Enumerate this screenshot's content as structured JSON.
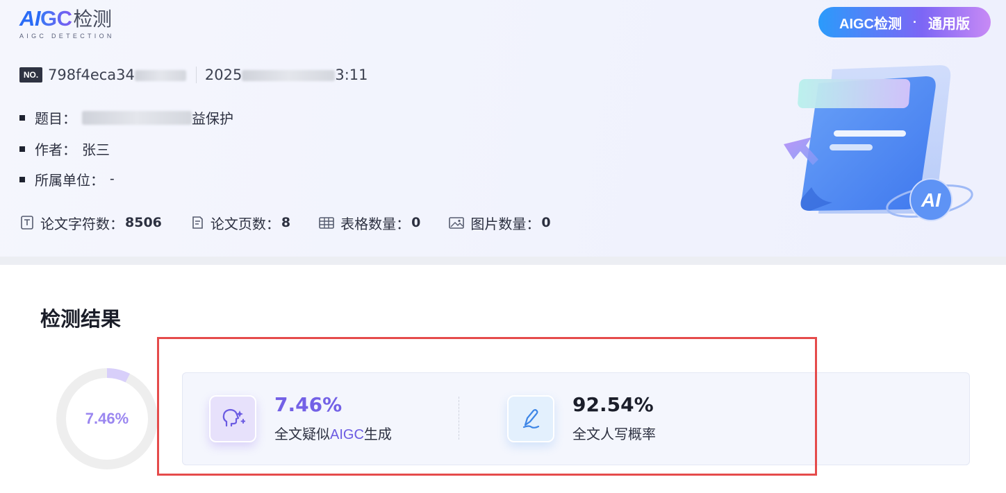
{
  "header": {
    "logo": {
      "ai": "AI",
      "gc": "GC",
      "cn": "检测",
      "sub": "AIGC DETECTION"
    },
    "badge": {
      "left": "AIGC检测",
      "dot": "·",
      "right": "通用版"
    },
    "meta": {
      "no_tag": "NO.",
      "id_prefix": "798f4eca34",
      "date_prefix": "2025",
      "date_suffix": "3:11"
    },
    "info": {
      "title_label": "题目：",
      "title_value_suffix": "益保护",
      "author_label": "作者：",
      "author_value": "张三",
      "unit_label": "所属单位：",
      "unit_value": "-"
    },
    "stats": [
      {
        "icon": "text-count-icon",
        "label": "论文字符数：",
        "value": "8506"
      },
      {
        "icon": "page-count-icon",
        "label": "论文页数：",
        "value": "8"
      },
      {
        "icon": "table-icon",
        "label": "表格数量：",
        "value": "0"
      },
      {
        "icon": "image-icon",
        "label": "图片数量：",
        "value": "0"
      }
    ],
    "illustration_text": "AI"
  },
  "result": {
    "title": "检测结果",
    "ring_label": "7.46%",
    "ring_fraction": 0.0746,
    "aigc": {
      "value": "7.46%",
      "label_pre": "全文疑似",
      "label_hl": "AIGC",
      "label_post": "生成"
    },
    "human": {
      "value": "92.54%",
      "label": "全文人写概率"
    }
  },
  "colors": {
    "accent": "#7361e6",
    "highlight_border": "#e54b4b",
    "ring_track": "#eeeeee",
    "ring_fill": "#d8cffa"
  }
}
